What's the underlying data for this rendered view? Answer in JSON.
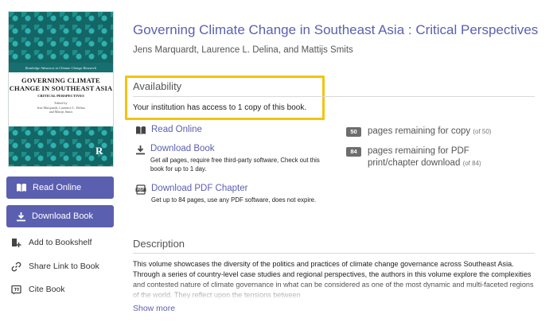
{
  "cover": {
    "series": "Routledge Advances in Climate Change Research",
    "title": "GOVERNING CLIMATE\nCHANGE IN SOUTHEAST ASIA",
    "subtitle": "CRITICAL PERSPECTIVES",
    "editors": "Edited by\nJens Marquardt, Laurence L. Delina\nand Mattijs Smits",
    "publisher_mark": "R"
  },
  "sidebar": {
    "read_online": "Read Online",
    "download_book": "Download Book",
    "add_to_bookshelf": "Add to Bookshelf",
    "share_link": "Share Link to Book",
    "cite_book": "Cite Book"
  },
  "book": {
    "title": "Governing Climate Change in Southeast Asia : Critical Perspectives",
    "authors": "Jens Marquardt, Laurence L. Delina, and Mattijs Smits"
  },
  "availability": {
    "heading": "Availability",
    "text": "Your institution has access to 1 copy of this book."
  },
  "options": {
    "read_online": {
      "label": "Read Online"
    },
    "download_book": {
      "label": "Download Book",
      "desc": "Get all pages, require free third-party software, Check out this book for up to 1 day."
    },
    "download_pdf": {
      "label": "Download PDF Chapter",
      "desc": "Get up to 84 pages, use any PDF software, does not expire."
    }
  },
  "counts": {
    "copy": {
      "badge": "50",
      "text": "pages remaining for copy",
      "small": "(of 50)"
    },
    "pdf": {
      "badge": "84",
      "text_line1": "pages remaining for PDF",
      "text_line2": "print/chapter download",
      "small": "(of 84)"
    }
  },
  "description": {
    "heading": "Description",
    "body": "This volume showcases the diversity of the politics and practices of climate change governance across Southeast Asia. Through a series of country-level case studies and regional perspectives, the authors in this volume explore the complexities and contested nature of climate governance in what can be considered as one of the most dynamic and multi-faceted regions of the world. They reflect upon the tensions between",
    "show_more": "Show more"
  },
  "colors": {
    "accent": "#5b5fb0",
    "highlight": "#f3c40f",
    "cover_teal": "#17706f",
    "badge": "#6d6d6d"
  }
}
